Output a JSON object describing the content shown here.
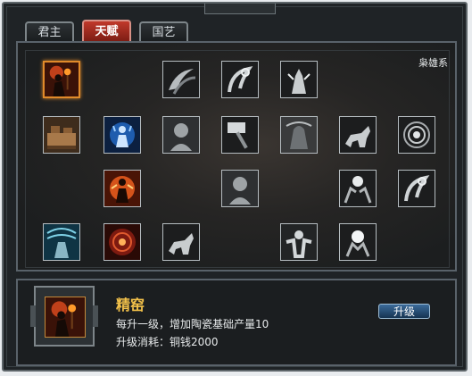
{
  "tabs": [
    {
      "label": "君主",
      "active": false
    },
    {
      "label": "天赋",
      "active": true
    },
    {
      "label": "国艺",
      "active": false
    }
  ],
  "tree": {
    "series_label": "枭雄系",
    "skills": [
      {
        "icon": "figure-with-torch-icon",
        "selected": true
      },
      {
        "icon": "claw-icon"
      },
      {
        "icon": "spiral-swoosh-icon"
      },
      {
        "icon": "praying-hands-icon"
      },
      {
        "icon": "fortress-icon"
      },
      {
        "icon": "blue-aura-figure-icon"
      },
      {
        "icon": "head-silhouette-icon"
      },
      {
        "icon": "hammer-icon"
      },
      {
        "icon": "hooded-figure-icon"
      },
      {
        "icon": "horse-rider-icon"
      },
      {
        "icon": "vortex-icon"
      },
      {
        "icon": "fire-aura-figure-icon"
      },
      {
        "icon": "head-silhouette-icon"
      },
      {
        "icon": "hands-orb-icon"
      },
      {
        "icon": "spiral-swoosh-icon"
      },
      {
        "icon": "storm-figure-icon"
      },
      {
        "icon": "red-vortex-icon"
      },
      {
        "icon": "horse-rider-icon"
      },
      {
        "icon": "power-figure-icon"
      },
      {
        "icon": "glowing-hands-icon"
      }
    ]
  },
  "detail": {
    "icon": "figure-with-torch-icon",
    "name": "精窑",
    "description": "每升一级，增加陶瓷基础产量10",
    "cost": "升级消耗：铜钱2000",
    "upgrade_label": "升级"
  },
  "colors": {
    "active_tab": "#c0392b",
    "skill_name": "#f2c14a",
    "selected_border": "#e08a2a",
    "button": "#2a5886"
  }
}
